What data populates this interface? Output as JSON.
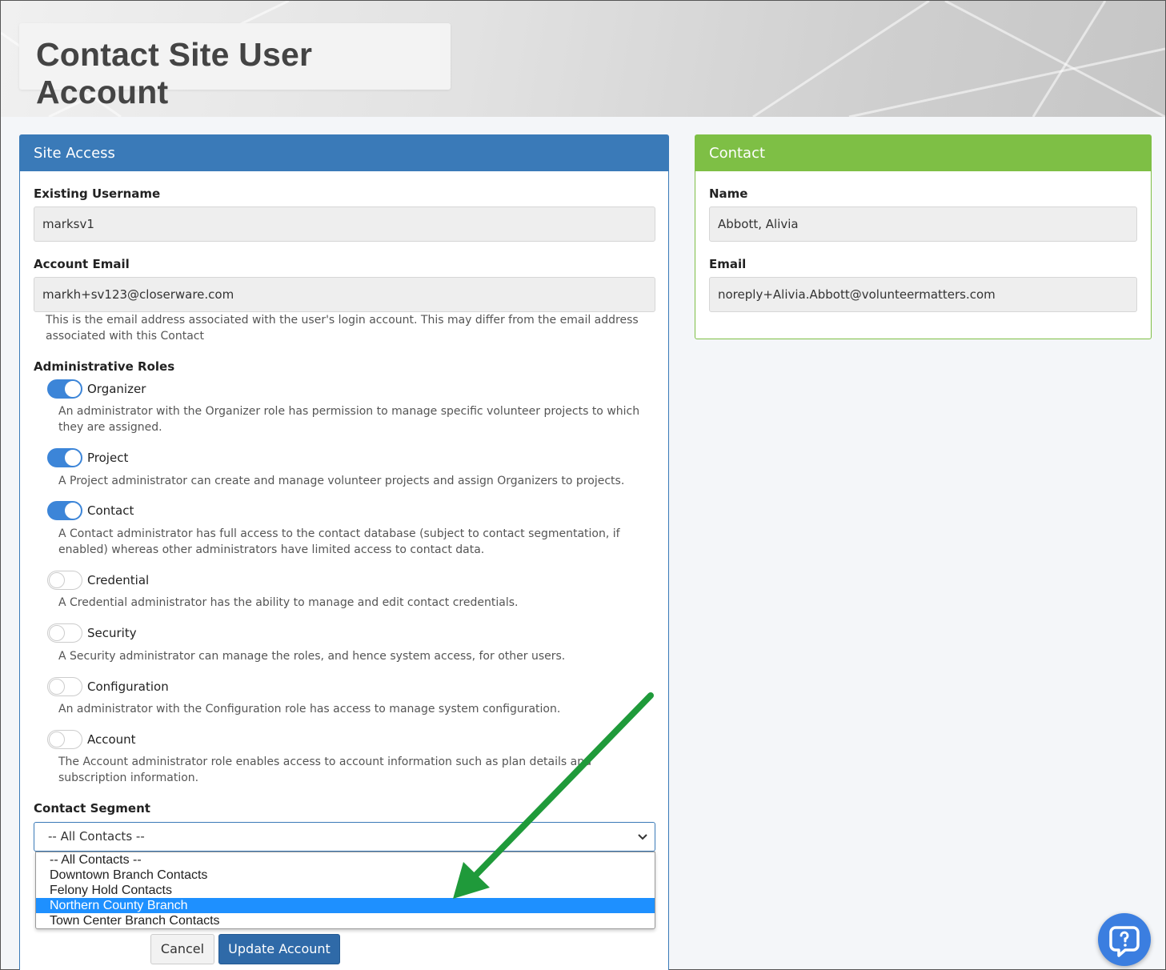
{
  "page": {
    "title": "Contact Site User Account"
  },
  "site_access": {
    "header": "Site Access",
    "username_label": "Existing Username",
    "username_value": "marksv1",
    "email_label": "Account Email",
    "email_value": "markh+sv123@closerware.com",
    "email_help": "This is the email address associated with the user's login account. This may differ from the email address associated with this Contact",
    "roles_label": "Administrative Roles",
    "roles": [
      {
        "name": "Organizer",
        "enabled": true,
        "description": "An administrator with the Organizer role has permission to manage specific volunteer projects to which they are assigned."
      },
      {
        "name": "Project",
        "enabled": true,
        "description": "A Project administrator can create and manage volunteer projects and assign Organizers to projects."
      },
      {
        "name": "Contact",
        "enabled": true,
        "description": "A Contact administrator has full access to the contact database (subject to contact segmentation, if enabled) whereas other administrators have limited access to contact data."
      },
      {
        "name": "Credential",
        "enabled": false,
        "description": "A Credential administrator has the ability to manage and edit contact credentials."
      },
      {
        "name": "Security",
        "enabled": false,
        "description": "A Security administrator can manage the roles, and hence system access, for other users."
      },
      {
        "name": "Configuration",
        "enabled": false,
        "description": "An administrator with the Configuration role has access to manage system configuration."
      },
      {
        "name": "Account",
        "enabled": false,
        "description": "The Account administrator role enables access to account information such as plan details and subscription information."
      }
    ],
    "segment_label": "Contact Segment",
    "segment_value": "-- All Contacts --",
    "segment_options": [
      "-- All Contacts --",
      "Downtown Branch Contacts",
      "Felony Hold Contacts",
      "Northern County Branch",
      "Town Center Branch Contacts"
    ],
    "segment_highlighted_index": 3,
    "cancel_label": "Cancel",
    "update_label": "Update Account"
  },
  "contact": {
    "header": "Contact",
    "name_label": "Name",
    "name_value": "Abbott, Alivia",
    "email_label": "Email",
    "email_value": "noreply+Alivia.Abbott@volunteermatters.com"
  },
  "colors": {
    "site_access_header": "#3a7ab8",
    "contact_header": "#7ebf45",
    "toggle_on": "#3c85d8",
    "option_highlight": "#1e90ff",
    "annotation_arrow": "#1f9a3a",
    "help_fab": "#3b7ee0"
  },
  "icons": {
    "select_chevron": "chevron-down-icon",
    "help_fab": "help-chat-icon"
  }
}
